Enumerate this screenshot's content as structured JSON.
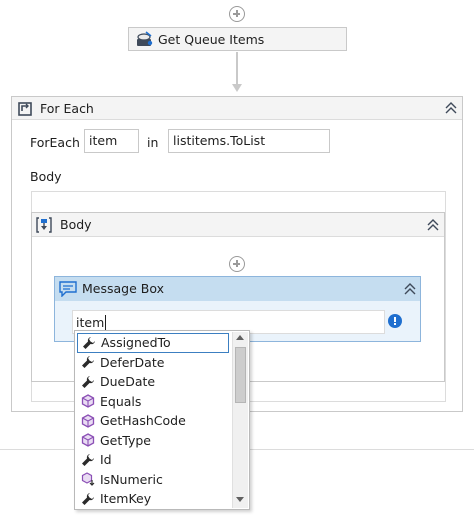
{
  "get_queue_items": {
    "title": "Get Queue Items"
  },
  "for_each": {
    "title": "For Each",
    "foreach_label": "ForEach",
    "item_value": "item",
    "in_label": "in",
    "collection_value": "listitems.ToList",
    "body_label": "Body"
  },
  "body_sequence": {
    "title": "Body"
  },
  "message_box": {
    "title": "Message Box",
    "text_value": "item"
  },
  "autocomplete": {
    "items": [
      {
        "label": "AssignedTo",
        "icon": "wrench-icon",
        "selected": true
      },
      {
        "label": "DeferDate",
        "icon": "wrench-icon"
      },
      {
        "label": "DueDate",
        "icon": "wrench-icon"
      },
      {
        "label": "Equals",
        "icon": "method-cube-icon"
      },
      {
        "label": "GetHashCode",
        "icon": "method-cube-icon"
      },
      {
        "label": "GetType",
        "icon": "method-cube-icon"
      },
      {
        "label": "Id",
        "icon": "wrench-icon"
      },
      {
        "label": "IsNumeric",
        "icon": "extension-method-icon"
      },
      {
        "label": "ItemKey",
        "icon": "wrench-icon"
      }
    ]
  },
  "colors": {
    "message_box_header": "#c5ddf0",
    "message_box_border": "#8db5dc",
    "selection_border": "#3c7fc1",
    "method_icon": "#8b4fb5",
    "warning_icon": "#1f6fcf"
  }
}
